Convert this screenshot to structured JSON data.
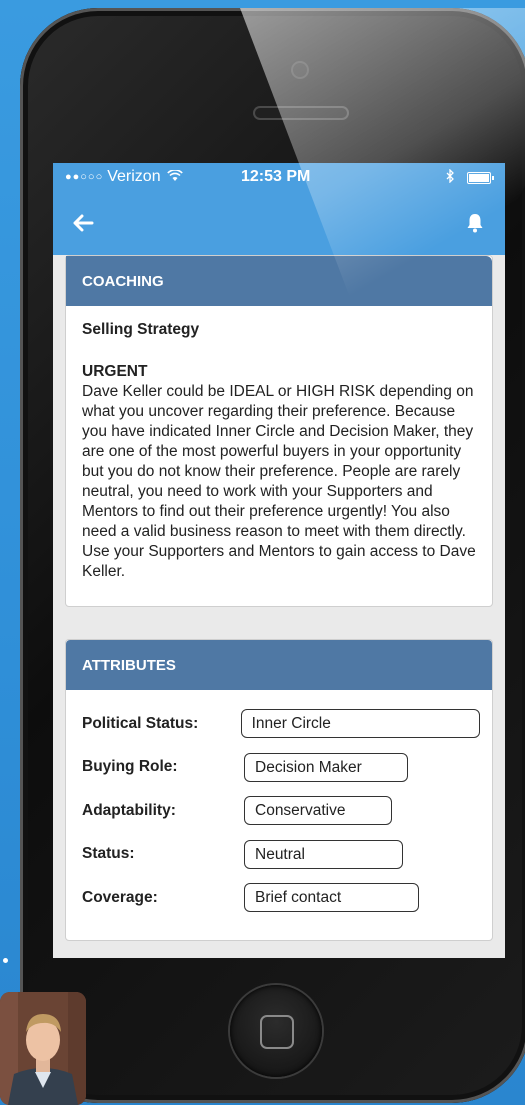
{
  "status_bar": {
    "signal": "●●○○○",
    "carrier": "Verizon",
    "time": "12:53 PM"
  },
  "nav": {
    "back_icon": "back-arrow-icon",
    "notify_icon": "bell-icon"
  },
  "coaching": {
    "header": "COACHING",
    "subtitle": "Selling Strategy",
    "urgent_label": "URGENT",
    "body": "Dave Keller could be IDEAL or HIGH RISK depending on what you uncover regarding their preference. Because you have indicated Inner Circle and Decision Maker, they are one of the most powerful buyers in your opportunity but you do not know their preference. People are rarely neutral, you need to work with your Supporters and Mentors to find out their preference urgently! You also need a valid business reason to meet with them directly. Use your Supporters and Mentors to gain access to Dave Keller."
  },
  "attributes": {
    "header": "ATTRIBUTES",
    "rows": [
      {
        "label": "Political Status:",
        "value": "Inner Circle"
      },
      {
        "label": "Buying Role:",
        "value": "Decision Maker"
      },
      {
        "label": "Adaptability:",
        "value": "Conservative"
      },
      {
        "label": "Status:",
        "value": "Neutral"
      },
      {
        "label": "Coverage:",
        "value": "Brief contact"
      }
    ]
  },
  "colors": {
    "accent": "#4a9fe0",
    "card_header": "#4f78a4",
    "background": "#2f8fd8"
  }
}
